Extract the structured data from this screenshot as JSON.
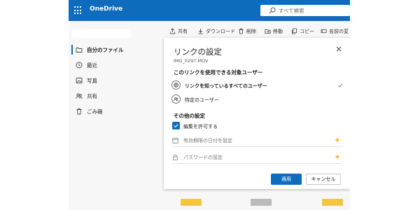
{
  "app": {
    "name": "OneDrive"
  },
  "search": {
    "placeholder": "すべて検索"
  },
  "sidebar": {
    "items": [
      {
        "label": "自分のファイル",
        "icon": "folder-icon",
        "active": true
      },
      {
        "label": "最近",
        "icon": "clock-icon"
      },
      {
        "label": "写真",
        "icon": "photo-icon"
      },
      {
        "label": "共有",
        "icon": "people-icon"
      },
      {
        "label": "ごみ箱",
        "icon": "trash-icon"
      }
    ]
  },
  "toolbar": {
    "share": "共有",
    "download": "ダウンロード",
    "delete": "削除",
    "move": "移動",
    "copy": "コピー",
    "rename": "名前の変"
  },
  "panel": {
    "title": "リンクの設定",
    "filename": "IMG_0297.MOV",
    "audience_heading": "このリンクを使用できる対象ユーザー",
    "options": [
      {
        "label": "リンクを知っているすべてのユーザー",
        "selected": true
      },
      {
        "label": "特定のユーザー",
        "selected": false
      }
    ],
    "other_heading": "その他の設定",
    "allow_edit": {
      "label": "編集を許可する",
      "checked": true
    },
    "expiry": "有効期限の日付を設定",
    "password": "パスワードの設定",
    "apply": "適用",
    "cancel": "キャンセル"
  },
  "colors": {
    "brand": "#0f6cbd",
    "premium": "#f0b429"
  }
}
